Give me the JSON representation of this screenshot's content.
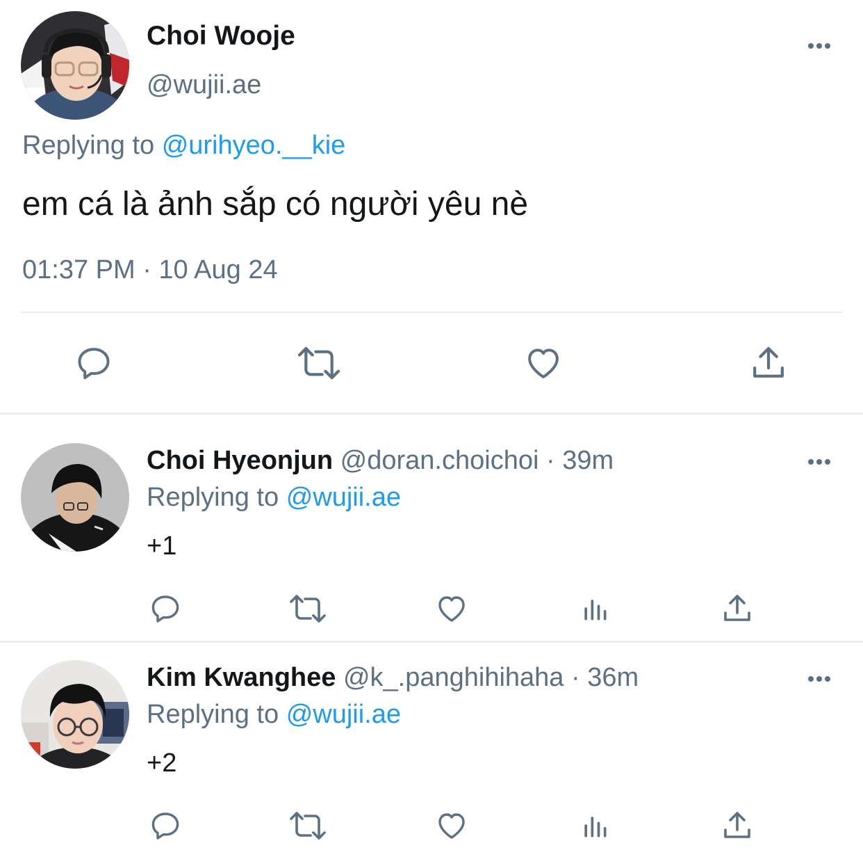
{
  "main_tweet": {
    "author_name": "Choi Wooje",
    "author_handle": "@wujii.ae",
    "replying_prefix": "Replying to",
    "replying_to": "@urihyeo.__kie",
    "text": "em cá là ảnh sắp có người yêu nè",
    "timestamp": "01:37 PM · 10 Aug 24",
    "actions": [
      "reply-icon",
      "retweet-icon",
      "like-icon",
      "share-icon"
    ]
  },
  "replies": [
    {
      "author_name": "Choi Hyeonjun",
      "author_handle": "@doran.choichoi",
      "separator": "·",
      "age": "39m",
      "replying_prefix": "Replying to",
      "replying_to": "@wujii.ae",
      "text": "+1",
      "actions": [
        "reply-icon",
        "retweet-icon",
        "like-icon",
        "analytics-icon",
        "share-icon"
      ]
    },
    {
      "author_name": "Kim Kwanghee",
      "author_handle": "@k_.panghihihaha",
      "separator": "·",
      "age": "36m",
      "replying_prefix": "Replying to",
      "replying_to": "@wujii.ae",
      "text": "+2",
      "actions": [
        "reply-icon",
        "retweet-icon",
        "like-icon",
        "analytics-icon",
        "share-icon"
      ]
    }
  ],
  "colors": {
    "text": "#14171a",
    "muted": "#5b7083",
    "link": "#1d9bf0",
    "divider": "#e6ecf0"
  }
}
